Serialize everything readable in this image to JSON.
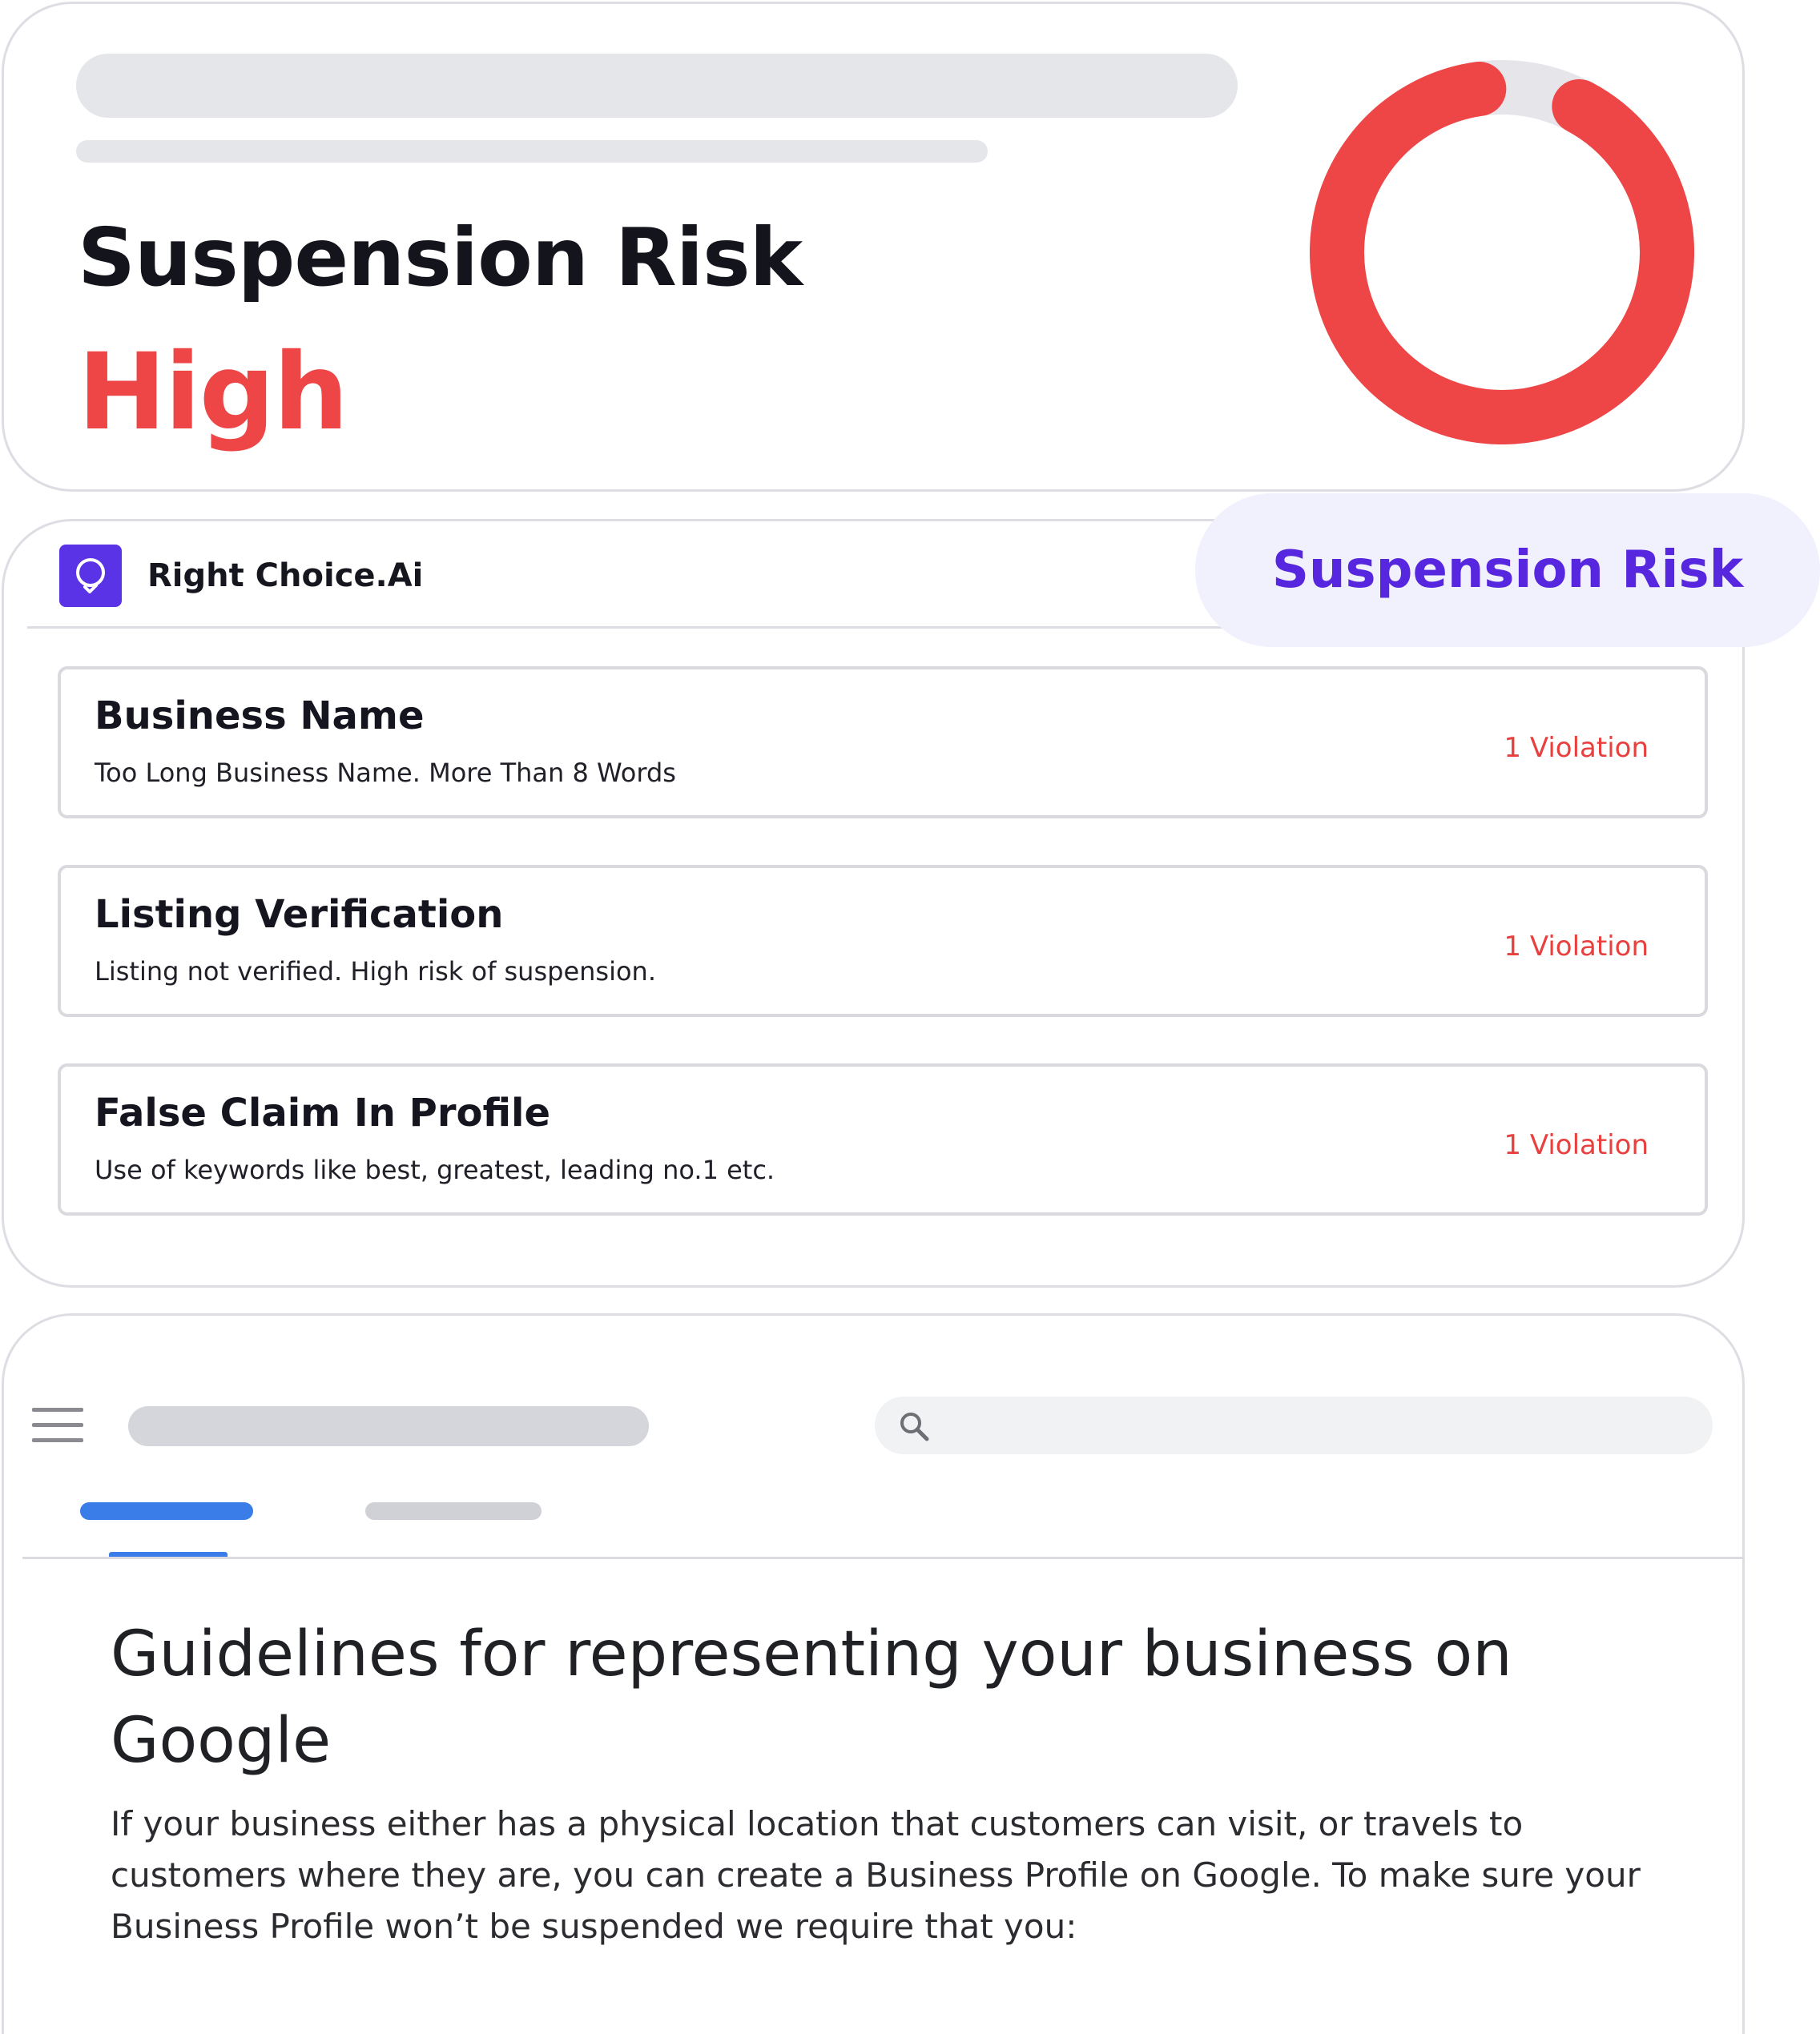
{
  "risk_card": {
    "title": "Suspension Risk",
    "level": "High",
    "gauge_fill_fraction": 0.9,
    "gauge_color": "#ee4646",
    "gauge_track_color": "#e6e6ea"
  },
  "violations_card": {
    "brand_name": "Right Choice.Ai",
    "brand_color": "#5b33e6",
    "badge_label": "Suspension Risk",
    "items": [
      {
        "title": "Business Name",
        "description": "Too Long Business Name. More Than 8 Words",
        "count": "1 Violation"
      },
      {
        "title": "Listing Verification",
        "description": "Listing not verified. High risk of suspension.",
        "count": "1 Violation"
      },
      {
        "title": "False Claim In Profile",
        "description": "Use of keywords like best, greatest, leading no.1 etc.",
        "count": "1 Violation"
      }
    ]
  },
  "guidelines_card": {
    "title": "Guidelines for representing your business on Google",
    "body": "If your business either has a physical location that customers can visit, or travels to customers where they are, you can create a Business Profile on Google. To make sure your Business Profile won’t be suspended we require that you:",
    "accent_color": "#3b7de8"
  }
}
